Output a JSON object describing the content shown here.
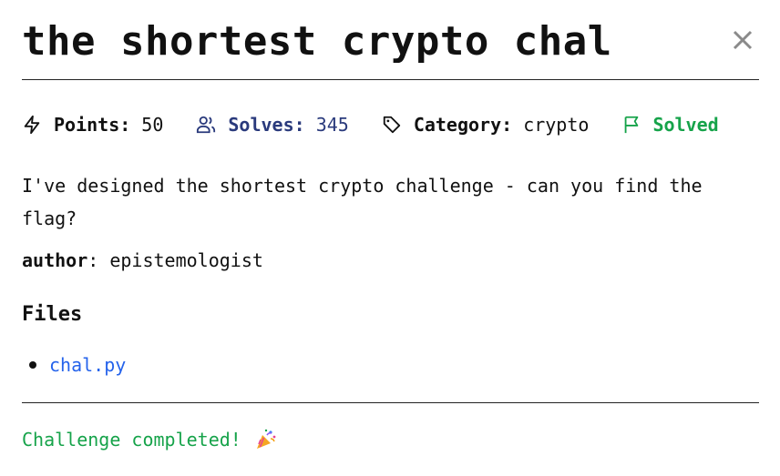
{
  "challenge": {
    "title": "the shortest crypto chal",
    "description": "I've designed the shortest crypto challenge - can you find the flag?",
    "author_label": "author",
    "author_value": "epistemologist"
  },
  "meta": {
    "points_label": "Points:",
    "points_value": "50",
    "solves_label": "Solves:",
    "solves_value": "345",
    "category_label": "Category:",
    "category_value": "crypto",
    "status_label": "Solved"
  },
  "files": {
    "heading": "Files",
    "items": [
      {
        "name": "chal.py"
      }
    ]
  },
  "footer": {
    "completed_message": "Challenge completed!"
  },
  "icons": {
    "points": "points-icon",
    "solves": "users-icon",
    "category": "tag-icon",
    "status": "flag-icon",
    "close": "close-icon",
    "celebration": "party-popper-icon"
  },
  "colors": {
    "solves": "#2a3a7c",
    "solved": "#16a34a",
    "link": "#2563eb",
    "completed": "#16a34a"
  }
}
